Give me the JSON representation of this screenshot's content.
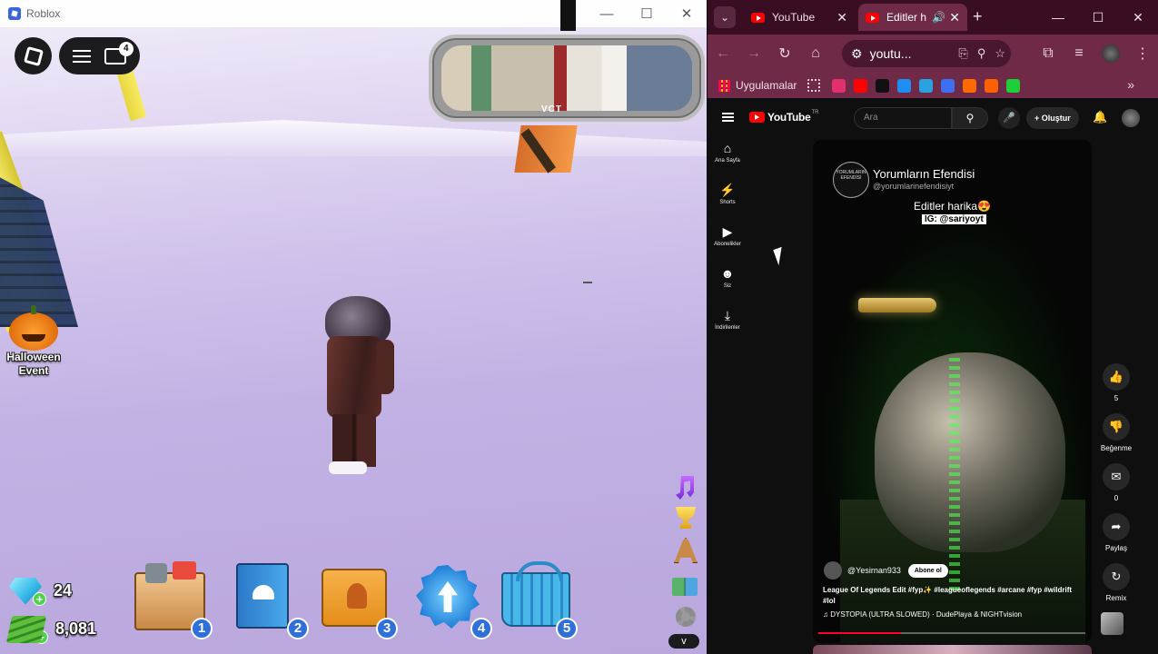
{
  "roblox": {
    "window_title": "Roblox",
    "menu_badge": "4",
    "event_label": "Halloween Event",
    "mirror_text": "VCT",
    "gems": "24",
    "cash": "8,081",
    "hotbar": [
      "1",
      "2",
      "3",
      "4",
      "5"
    ],
    "more_label": "v"
  },
  "chrome": {
    "tabs": [
      {
        "label": "YouTube"
      },
      {
        "label": "Editler h"
      }
    ],
    "url": "youtu...",
    "bookmarks_apps_label": "Uygulamalar",
    "bookmark_icons": [
      {
        "name": "instagram-icon",
        "color": "#e1306c"
      },
      {
        "name": "youtube-icon",
        "color": "#ff0000"
      },
      {
        "name": "tiktok-icon",
        "color": "#111111"
      },
      {
        "name": "checkmark-icon",
        "color": "#1f8ef1"
      },
      {
        "name": "c-icon",
        "color": "#2aa1e0"
      },
      {
        "name": "blue-square-icon",
        "color": "#3e6ff2"
      },
      {
        "name": "orange-circle-icon",
        "color": "#ff6a00"
      },
      {
        "name": "hb-icon",
        "color": "#ff6000"
      },
      {
        "name": "k-icon",
        "color": "#1ecf3a"
      }
    ]
  },
  "youtube": {
    "logo_text": "YouTube",
    "country_code": "TR",
    "search_placeholder": "Ara",
    "create_label": "+ Oluştur",
    "sidebar": [
      {
        "label": "Ana Sayfa",
        "icon": "home-icon"
      },
      {
        "label": "Shorts",
        "icon": "shorts-icon"
      },
      {
        "label": "Abonelikler",
        "icon": "subscriptions-icon"
      },
      {
        "label": "Siz",
        "icon": "you-icon"
      },
      {
        "label": "İndirilenler",
        "icon": "downloads-icon"
      }
    ],
    "short": {
      "channel_name": "Yorumların Efendisi",
      "channel_handle": "@yorumlarinefendisiyt",
      "channel_logo_text": "YORUMLARIN EFENDİSİ",
      "caption_line1": "Editler harika😍",
      "caption_line2": "IG: @sariyoyt",
      "uploader": "@Yesirnan933",
      "subscribe_label": "Abone ol",
      "title": "League Of Legends Edit #fyp✨ #leagueoflegends #arcane #fyp #wildrift #lol",
      "sound": "DYSTOPIA (ULTRA SLOWED) · DudePlaya & NIGHTvision",
      "progress": 0.31
    },
    "actions": [
      {
        "label": "5",
        "icon": "like-icon"
      },
      {
        "label": "Beğenme",
        "icon": "dislike-icon"
      },
      {
        "label": "0",
        "icon": "comment-icon"
      },
      {
        "label": "Paylaş",
        "icon": "share-icon"
      },
      {
        "label": "Remix",
        "icon": "remix-icon"
      }
    ]
  }
}
